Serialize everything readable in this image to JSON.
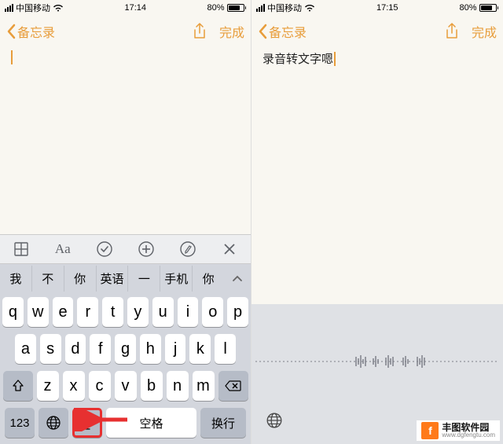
{
  "left": {
    "status": {
      "carrier": "中国移动",
      "time": "17:14",
      "battery_pct": "80%"
    },
    "nav": {
      "back_label": "备忘录",
      "done_label": "完成"
    },
    "content": {
      "text": ""
    },
    "suggest_icons": [
      "grid-icon",
      "aa-icon",
      "check-icon",
      "plus-icon",
      "pencil-icon",
      "close-icon"
    ],
    "predictions": [
      "我",
      "不",
      "你",
      "英语",
      "一",
      "手机",
      "你"
    ],
    "kb_row1": [
      "q",
      "w",
      "e",
      "r",
      "t",
      "y",
      "u",
      "i",
      "o",
      "p"
    ],
    "kb_row2": [
      "a",
      "s",
      "d",
      "f",
      "g",
      "h",
      "j",
      "k",
      "l"
    ],
    "kb_row3": [
      "z",
      "x",
      "c",
      "v",
      "b",
      "n",
      "m"
    ],
    "bottom": {
      "k123": "123",
      "space": "空格",
      "return_": "换行"
    }
  },
  "right": {
    "status": {
      "carrier": "中国移动",
      "time": "17:15",
      "battery_pct": "80%"
    },
    "nav": {
      "back_label": "备忘录",
      "done_label": "完成"
    },
    "content": {
      "text": "录音转文字嗯"
    }
  },
  "watermark": {
    "logo": "f",
    "text": "丰图软件园",
    "sub": "www.dgfengtu.com"
  }
}
